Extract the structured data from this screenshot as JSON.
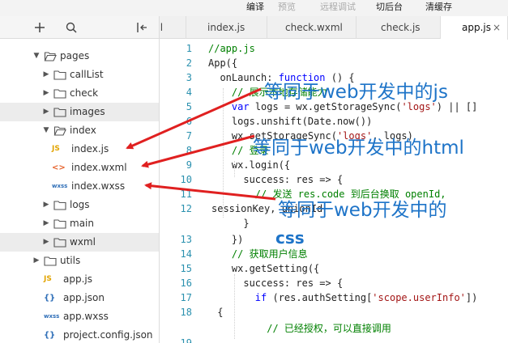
{
  "menu": [
    "编译",
    "预览",
    "远程调试",
    "切后台",
    "清缓存"
  ],
  "tabs": [
    {
      "label": "ml"
    },
    {
      "label": "index.js"
    },
    {
      "label": "check.wxml"
    },
    {
      "label": "check.js"
    },
    {
      "label": "app.js",
      "active": true,
      "close": "×"
    }
  ],
  "explorer": {
    "icons": [
      "plus-icon",
      "search-icon",
      "split-icon"
    ],
    "tree": [
      {
        "label": "pages",
        "kind": "folder",
        "open": true
      },
      {
        "label": "callList",
        "kind": "folder"
      },
      {
        "label": "check",
        "kind": "folder"
      },
      {
        "label": "images",
        "kind": "folder",
        "selected": true
      },
      {
        "label": "index",
        "kind": "folder",
        "open": true
      },
      {
        "label": "index.js",
        "kind": "file",
        "type": "JS"
      },
      {
        "label": "index.wxml",
        "kind": "file",
        "type": "<>"
      },
      {
        "label": "index.wxss",
        "kind": "file",
        "type": "wxss"
      },
      {
        "label": "logs",
        "kind": "folder"
      },
      {
        "label": "main",
        "kind": "folder"
      },
      {
        "label": "wxml",
        "kind": "folder",
        "selected": true
      },
      {
        "label": "utils",
        "kind": "folder"
      },
      {
        "label": "app.js",
        "kind": "file",
        "type": "JS"
      },
      {
        "label": "app.json",
        "kind": "file",
        "type": "{}"
      },
      {
        "label": "app.wxss",
        "kind": "file",
        "type": "wxss"
      },
      {
        "label": "project.config.json",
        "kind": "file",
        "type": "{}"
      }
    ]
  },
  "code": {
    "line_numbers": [
      "1",
      "2",
      "3",
      "4",
      "5",
      "6",
      "7",
      "8",
      "9",
      "10",
      "11",
      "12",
      "",
      "13",
      "14",
      "15",
      "16",
      "17",
      "18",
      "",
      "19"
    ],
    "lines": [
      "//app.js",
      "App({",
      "  onLaunch: function () {",
      "    // 展示本地存储能力",
      "    var logs = wx.getStorageSync('logs') || []",
      "    logs.unshift(Date.now())",
      "    wx.setStorageSync('logs', logs)",
      "    // 登录",
      "    wx.login({",
      "      success: res => {",
      "        // 发送 res.code 到后台换取 openId,",
      "sessionKey, unionId",
      "      }",
      "    })",
      "    // 获取用户信息",
      "    wx.getSetting({",
      "      success: res => {",
      "        if (res.authSetting['scope.userInfo'])",
      " {",
      "          // 已经授权，可以直接调用"
    ]
  },
  "annotations": [
    {
      "text": "等同于web开发中的js"
    },
    {
      "text": "等同于web开发中的html"
    },
    {
      "text": "等同于web开发中的"
    },
    {
      "text": "css"
    }
  ],
  "colors": {
    "annotation": "#1e74c8",
    "arrow": "#e02020",
    "keyword": "#0000ff",
    "comment": "#008000",
    "string": "#a31515",
    "line_number": "#2b91af"
  }
}
